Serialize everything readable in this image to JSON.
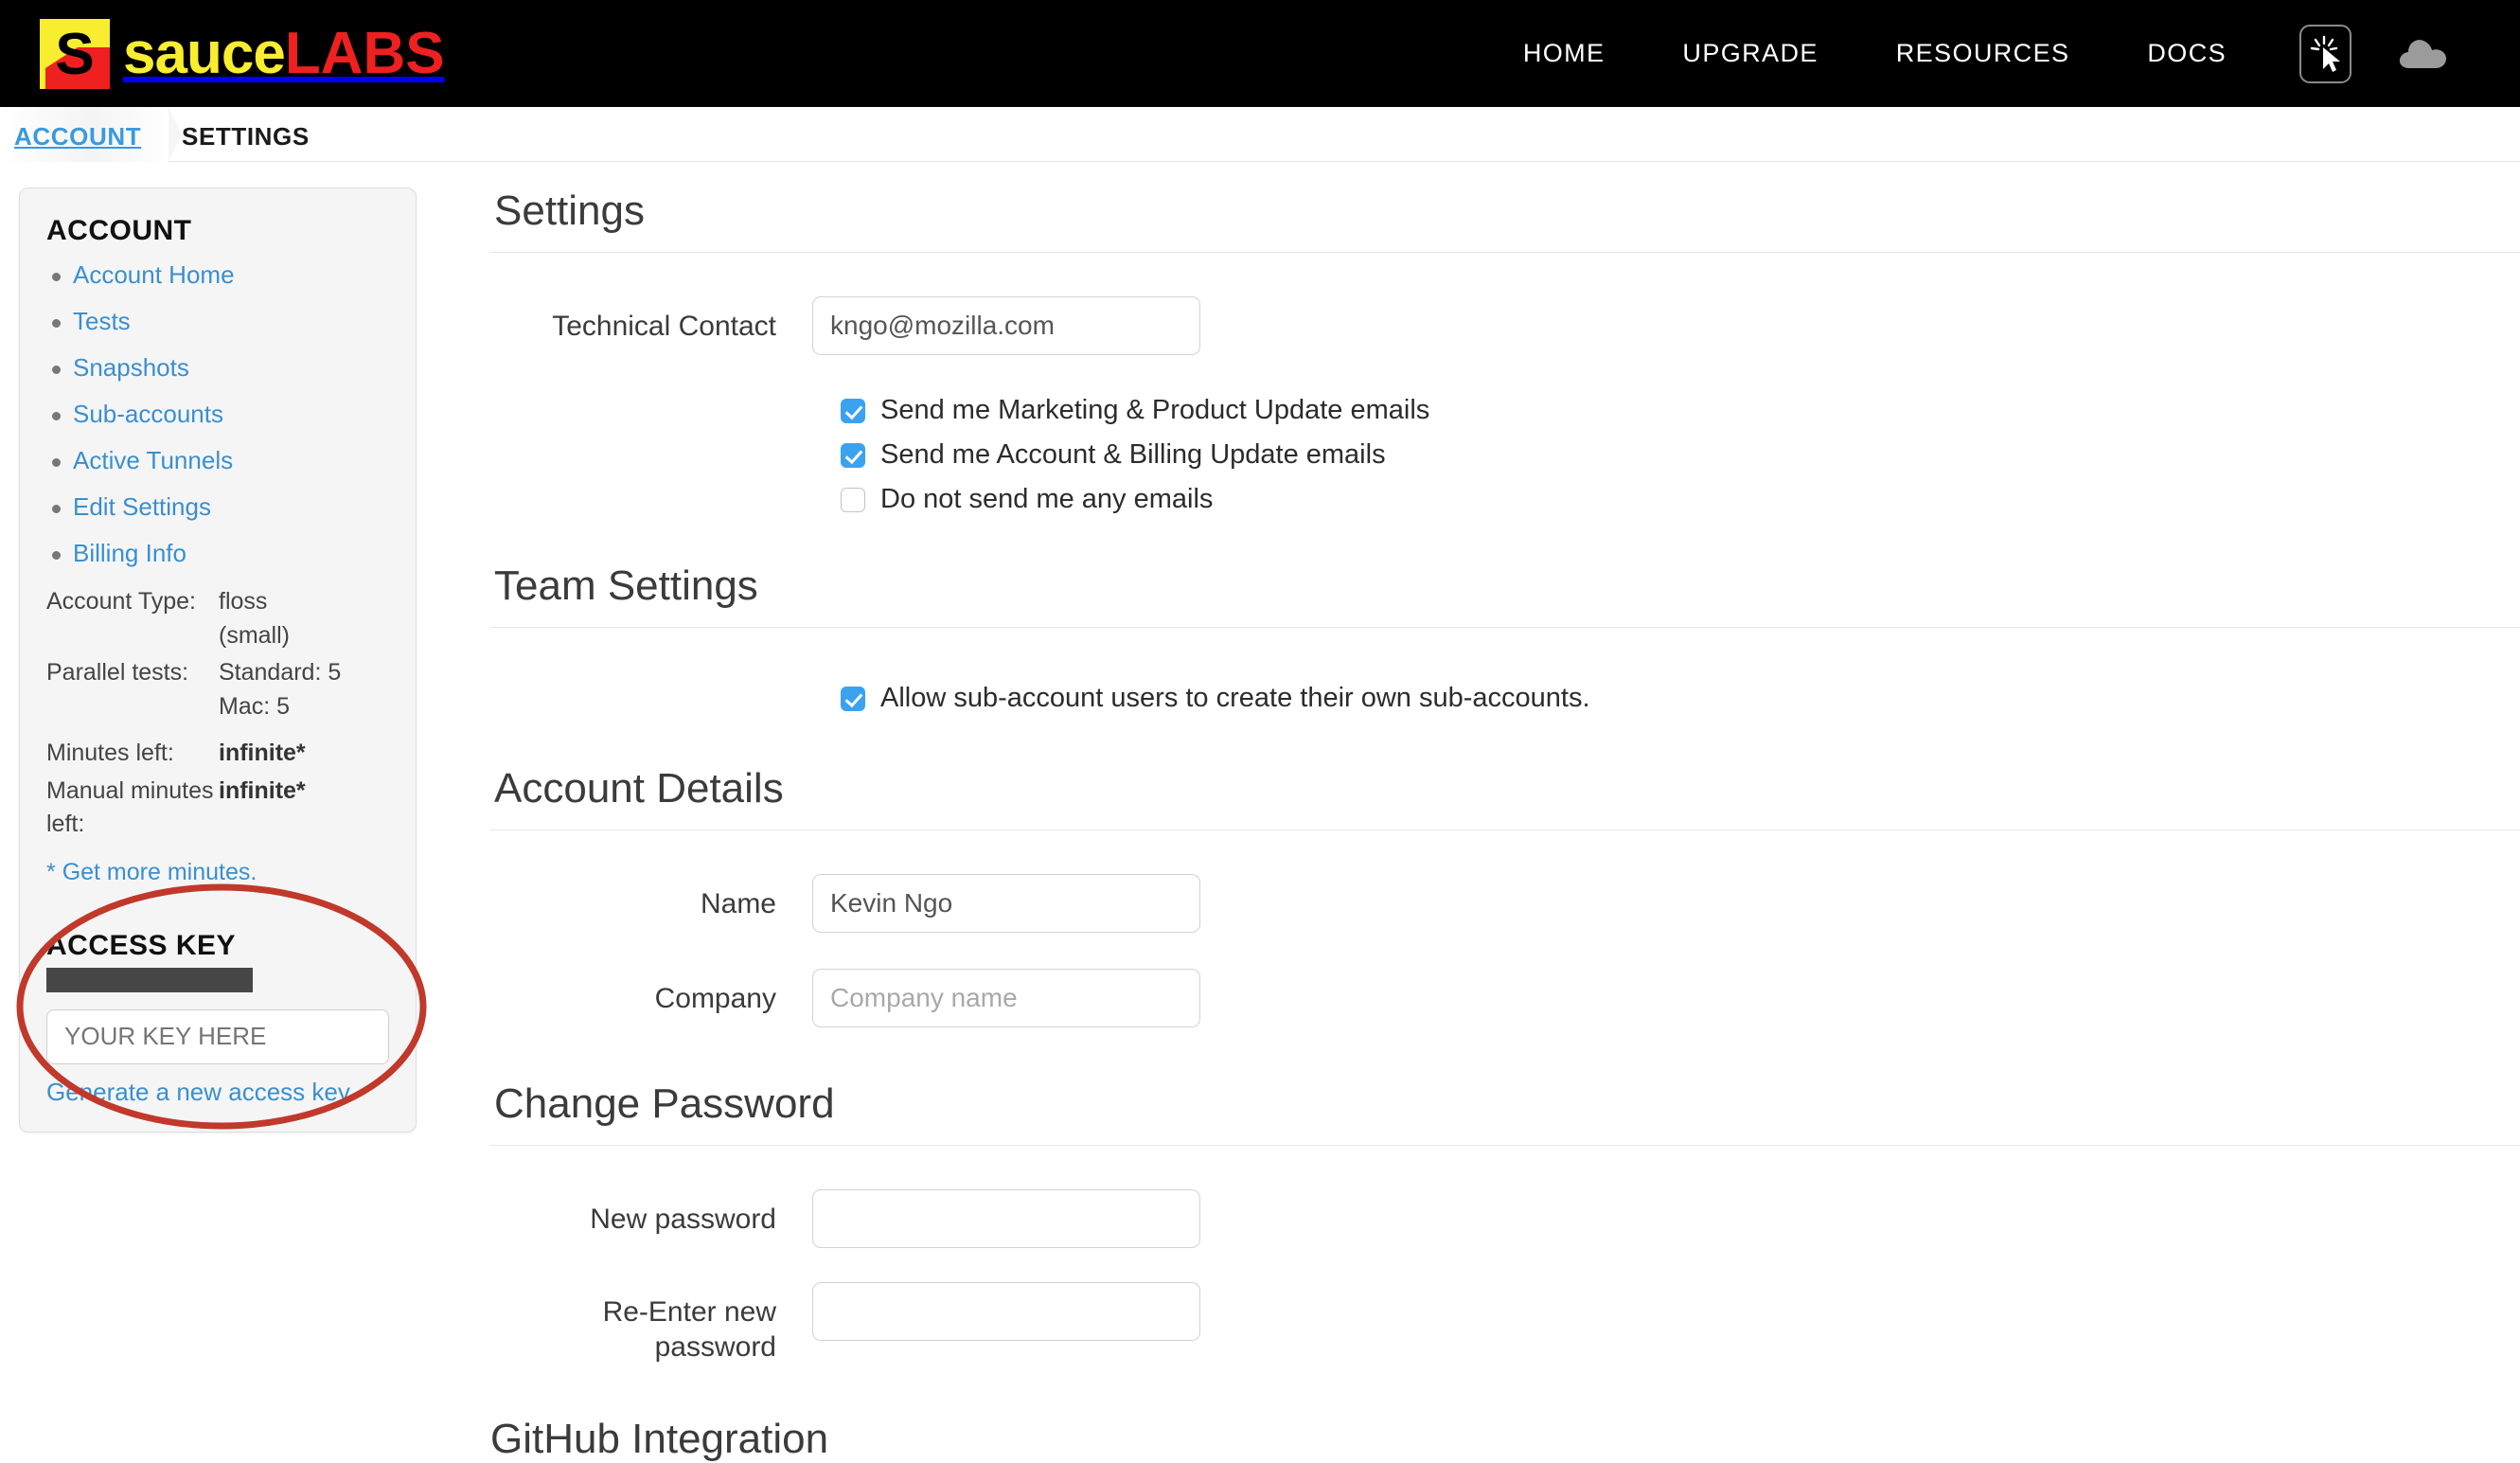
{
  "brand": {
    "name_part1": "sauce",
    "name_part2": "LABS",
    "logo_letter": "S",
    "yellow": "#f8ed2e",
    "red": "#ee2020"
  },
  "topnav": {
    "links": [
      {
        "label": "HOME"
      },
      {
        "label": "UPGRADE"
      },
      {
        "label": "RESOURCES"
      },
      {
        "label": "DOCS"
      }
    ],
    "icons": [
      {
        "name": "cursor-click-icon"
      },
      {
        "name": "cloud-icon"
      }
    ]
  },
  "breadcrumb": {
    "account": "ACCOUNT",
    "current": "SETTINGS",
    "account_color": "#3a9ade"
  },
  "sidebar": {
    "title": "ACCOUNT",
    "items": [
      {
        "label": "Account Home"
      },
      {
        "label": "Tests"
      },
      {
        "label": "Snapshots"
      },
      {
        "label": "Sub-accounts"
      },
      {
        "label": "Active Tunnels"
      },
      {
        "label": "Edit Settings"
      },
      {
        "label": "Billing Info"
      }
    ],
    "stats": [
      {
        "key": "Account Type:",
        "value": "floss\n(small)",
        "bold": false
      },
      {
        "key": "Parallel tests:",
        "value": "Standard: 5\nMac: 5",
        "bold": false
      },
      {
        "key": "Minutes left:",
        "value": "infinite*",
        "bold": true
      },
      {
        "key": "Manual minutes left:",
        "value": "infinite*",
        "bold": true
      }
    ],
    "get_more_star": "* ",
    "get_more_link": "Get more minutes.",
    "access_key": {
      "title": "ACCESS KEY",
      "redacted": true,
      "input_placeholder": "YOUR KEY HERE",
      "input_value": "",
      "generate_link": "Generate a new access key"
    },
    "annotation": {
      "shape": "ellipse",
      "color": "#c0392b"
    }
  },
  "main": {
    "sections": [
      {
        "id": "settings",
        "title": "Settings",
        "fields": [
          {
            "label": "Technical Contact",
            "value": "kngo@mozilla.com",
            "placeholder": ""
          }
        ],
        "checkboxes": [
          {
            "label": "Send me Marketing & Product Update emails",
            "checked": true
          },
          {
            "label": "Send me Account & Billing Update emails",
            "checked": true
          },
          {
            "label": "Do not send me any emails",
            "checked": false
          }
        ]
      },
      {
        "id": "team-settings",
        "title": "Team Settings",
        "fields": [],
        "checkboxes": [
          {
            "label": "Allow sub-account users to create their own sub-accounts.",
            "checked": true
          }
        ]
      },
      {
        "id": "account-details",
        "title": "Account Details",
        "fields": [
          {
            "label": "Name",
            "value": "Kevin Ngo",
            "placeholder": ""
          },
          {
            "label": "Company",
            "value": "",
            "placeholder": "Company name"
          }
        ],
        "checkboxes": []
      },
      {
        "id": "change-password",
        "title": "Change Password",
        "fields": [
          {
            "label": "New password",
            "value": "",
            "placeholder": ""
          },
          {
            "label": "Re-Enter new password",
            "value": "",
            "placeholder": ""
          }
        ],
        "checkboxes": []
      }
    ],
    "cut_off_section_title": "GitHub Integration"
  },
  "colors": {
    "link": "#3a8fd0",
    "checkbox_on": "#3ba2f0",
    "panel_bg": "#f5f5f5",
    "rule": "#e6e6e6"
  }
}
